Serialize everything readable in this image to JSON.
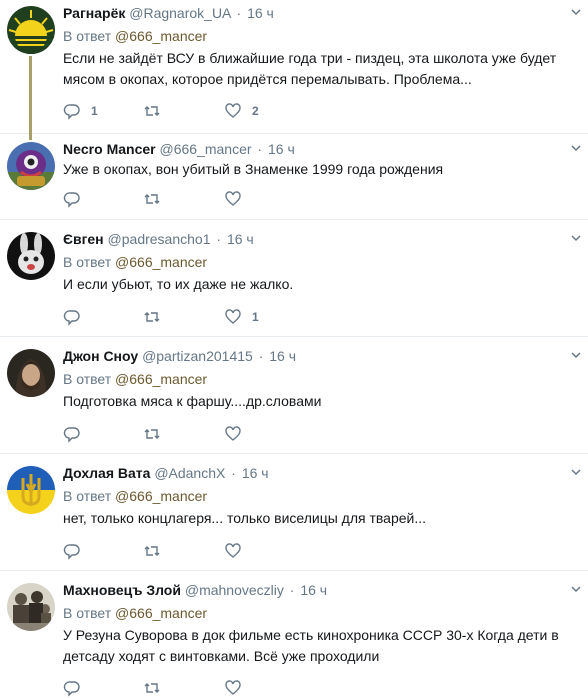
{
  "tweets": [
    {
      "name": "Рагнарёк",
      "handle": "@Ragnarok_UA",
      "sep": "·",
      "time": "16 ч",
      "reply_prefix": "В ответ",
      "reply_to": "@666_mancer",
      "text": "Если не зайдёт ВСУ в ближайшие года три - пиздец, эта школота уже будет мясом в окопах, которое придётся перемалывать. Проблема...",
      "replies": "1",
      "retweets": "",
      "likes": "2",
      "avatar": "sun-flag-avatar"
    },
    {
      "name": "Necro Mancer",
      "handle": "@666_mancer",
      "sep": "·",
      "time": "16 ч",
      "reply_prefix": "",
      "reply_to": "",
      "text": "Уже в окопах, вон убитый в Знаменке 1999 года рождения",
      "replies": "",
      "retweets": "",
      "likes": "",
      "avatar": "purple-creature-avatar"
    },
    {
      "name": "Євген",
      "handle": "@padresancho1",
      "sep": "·",
      "time": "16 ч",
      "reply_prefix": "В ответ",
      "reply_to": "@666_mancer",
      "text": "И если убьют, то их даже не жалко.",
      "replies": "",
      "retweets": "",
      "likes": "1",
      "avatar": "rabbit-avatar"
    },
    {
      "name": "Джон Сноу",
      "handle": "@partizan201415",
      "sep": "·",
      "time": "16 ч",
      "reply_prefix": "В ответ",
      "reply_to": "@666_mancer",
      "text": "Подготовка мяса к фаршу....др.словами",
      "replies": "",
      "retweets": "",
      "likes": "",
      "avatar": "portrait-avatar"
    },
    {
      "name": "Дохлая Вата",
      "handle": "@AdanchX",
      "sep": "·",
      "time": "16 ч",
      "reply_prefix": "В ответ",
      "reply_to": "@666_mancer",
      "text": "нет, только концлагеря... только виселицы для тварей...",
      "replies": "",
      "retweets": "",
      "likes": "",
      "avatar": "trident-flag-avatar"
    },
    {
      "name": "Махновецъ Злой",
      "handle": "@mahnoveczliy",
      "sep": "·",
      "time": "16 ч",
      "reply_prefix": "В ответ",
      "reply_to": "@666_mancer",
      "text": "У Резуна Суворова в док фильме есть кинохроника  СССР 30-х  Когда дети в детсаду ходят с винтовками. Всё уже проходили",
      "replies": "",
      "retweets": "",
      "likes": "",
      "avatar": "group-photo-avatar"
    }
  ],
  "colors": {
    "text": "#14171a",
    "muted": "#657786",
    "mention": "#6b5a2f",
    "divider": "#e6ecf0",
    "thread_line": "#a89f6a"
  }
}
